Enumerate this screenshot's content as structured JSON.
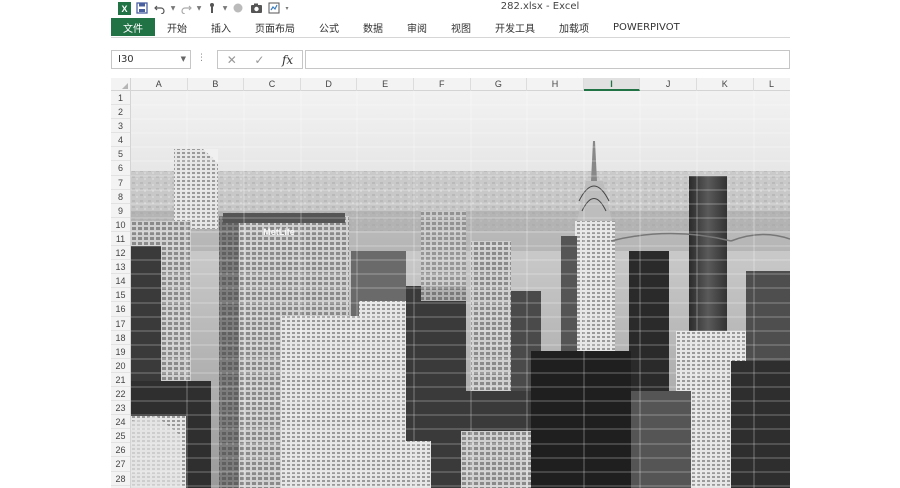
{
  "window": {
    "title": "282.xlsx - Excel"
  },
  "qat": {
    "icons": [
      "excel-icon",
      "save-icon",
      "undo-icon",
      "redo-icon",
      "touch-mode-icon",
      "record-icon",
      "camera-icon",
      "form-icon",
      "customize-icon"
    ]
  },
  "ribbon": {
    "tabs": [
      "文件",
      "开始",
      "插入",
      "页面布局",
      "公式",
      "数据",
      "审阅",
      "视图",
      "开发工具",
      "加载项",
      "POWERPIVOT"
    ]
  },
  "formula_bar": {
    "name_box": "I30",
    "fx_label": "fx",
    "formula": ""
  },
  "grid": {
    "columns": [
      "A",
      "B",
      "C",
      "D",
      "E",
      "F",
      "G",
      "H",
      "I",
      "J",
      "K",
      "L"
    ],
    "selected_column": "I",
    "rows": [
      "1",
      "2",
      "3",
      "4",
      "5",
      "6",
      "7",
      "8",
      "9",
      "10",
      "11",
      "12",
      "13",
      "14",
      "15",
      "16",
      "17",
      "18",
      "19",
      "20",
      "21",
      "22",
      "23",
      "24",
      "25",
      "26",
      "27",
      "28"
    ]
  },
  "image": {
    "sign_text": "MetLife"
  },
  "colors": {
    "accent": "#217346"
  }
}
